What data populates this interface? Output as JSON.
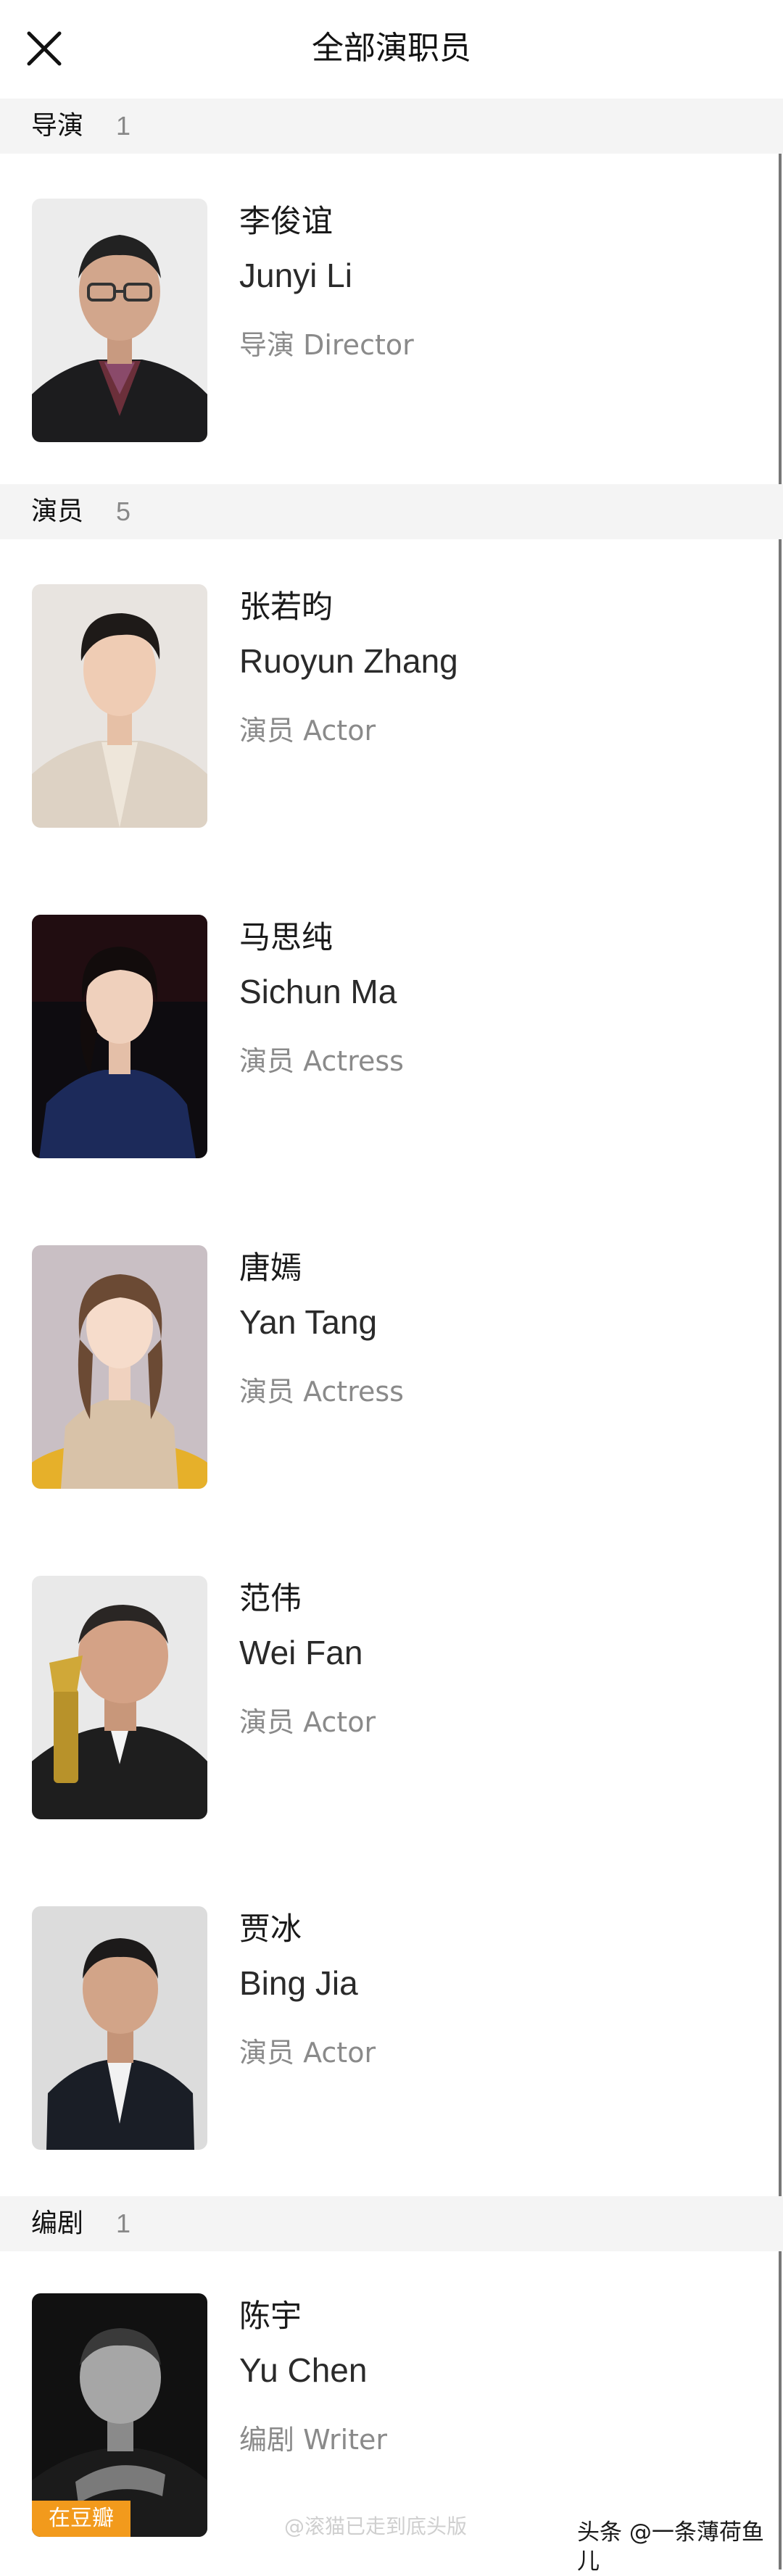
{
  "header": {
    "title": "全部演职员",
    "close_icon": "close-icon"
  },
  "sections": {
    "director": {
      "name": "导演",
      "count": "1"
    },
    "cast": {
      "name": "演员",
      "count": "5"
    },
    "writer": {
      "name": "编剧",
      "count": "1"
    }
  },
  "people": {
    "junyi_li": {
      "name_cn": "李俊谊",
      "name_en": "Junyi Li",
      "role": "导演 Director"
    },
    "ruoyun_zhang": {
      "name_cn": "张若昀",
      "name_en": "Ruoyun Zhang",
      "role": "演员 Actor"
    },
    "sichun_ma": {
      "name_cn": "马思纯",
      "name_en": "Sichun Ma",
      "role": "演员 Actress"
    },
    "yan_tang": {
      "name_cn": "唐嫣",
      "name_en": "Yan Tang",
      "role": "演员 Actress"
    },
    "wei_fan": {
      "name_cn": "范伟",
      "name_en": "Wei Fan",
      "role": "演员 Actor"
    },
    "bing_jia": {
      "name_cn": "贾冰",
      "name_en": "Bing Jia",
      "role": "演员 Actor"
    },
    "yu_chen": {
      "name_cn": "陈宇",
      "name_en": "Yu Chen",
      "role": "编剧 Writer",
      "badge": "在豆瓣"
    }
  },
  "footer": {
    "watermark": "@滚猫已走到底头版",
    "source": "头条 @一条薄荷鱼儿"
  },
  "colors": {
    "section_bg": "#f4f4f4",
    "role_text": "#8a8a8a",
    "douban_badge": "#f29a1c"
  }
}
